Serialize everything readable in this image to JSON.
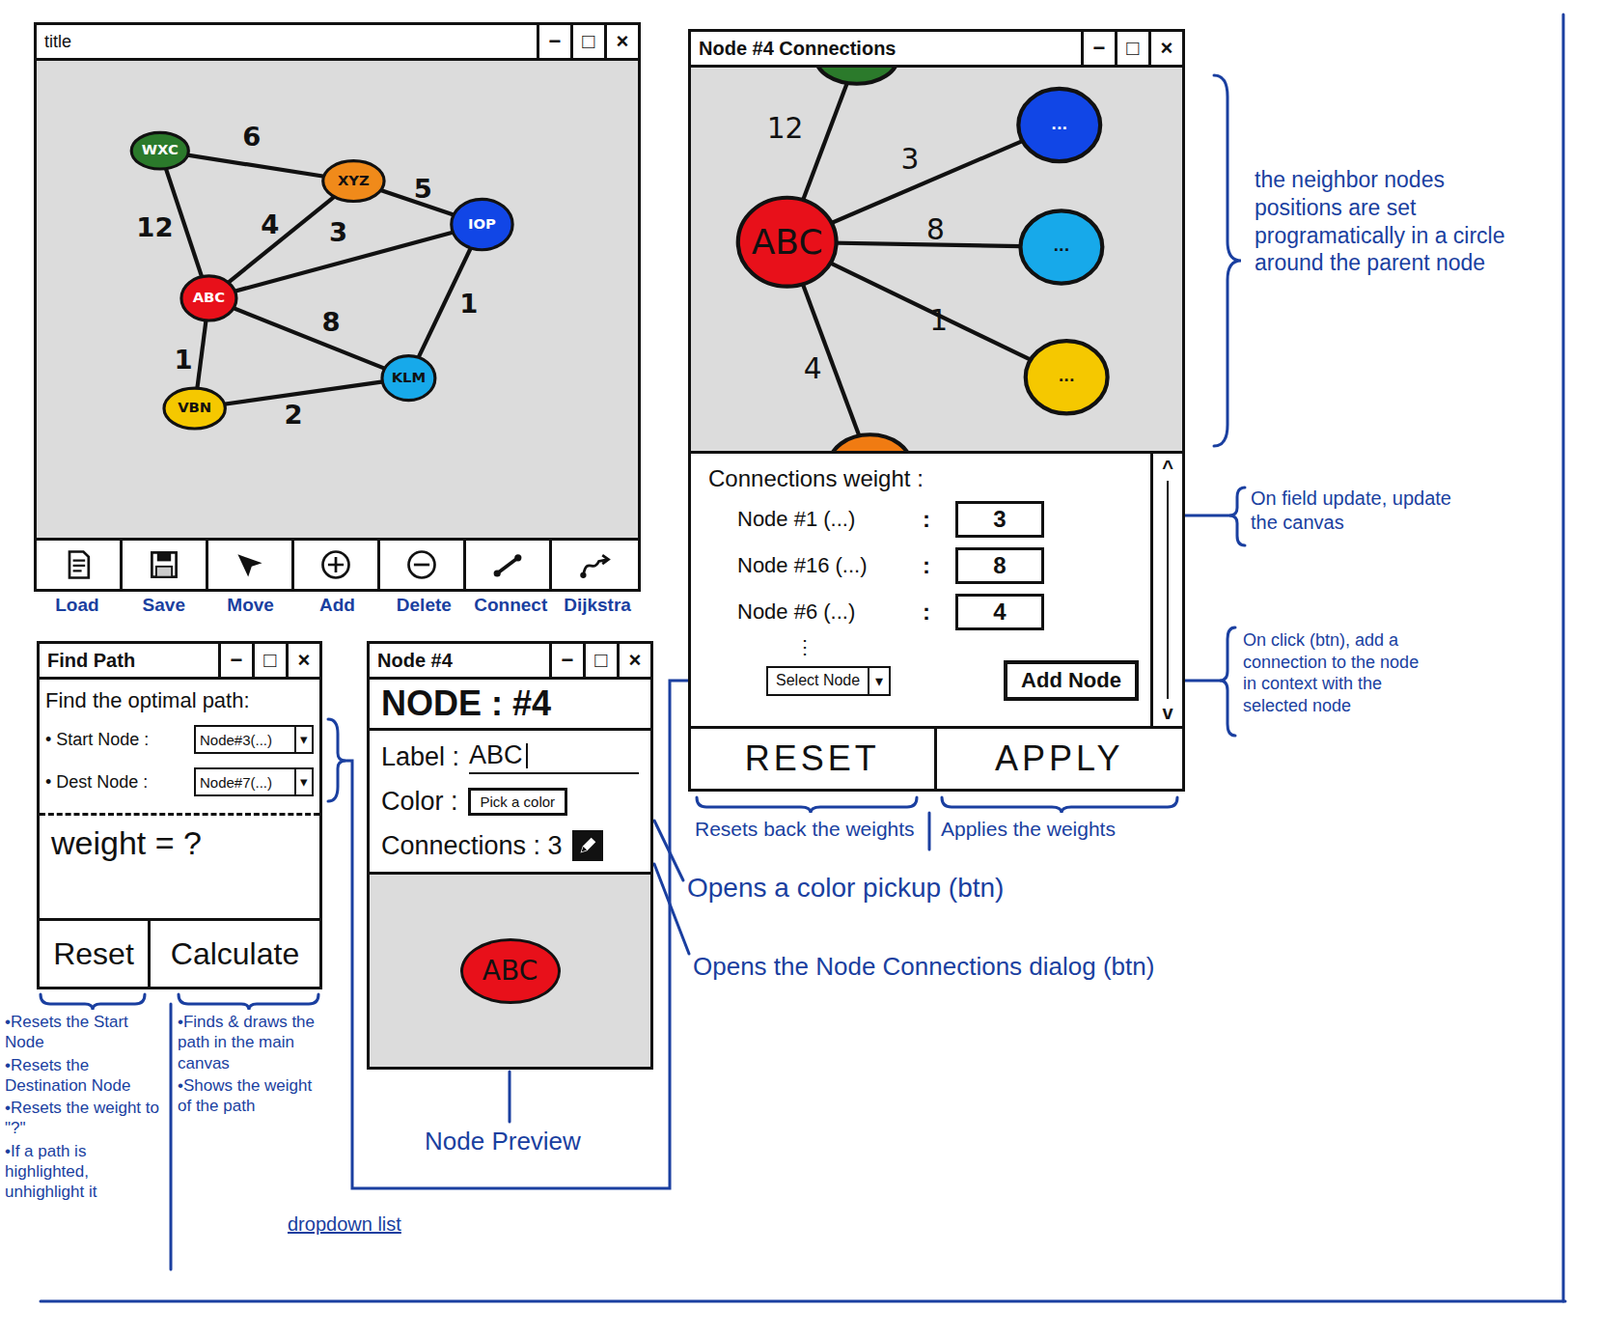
{
  "main_window": {
    "title": "title",
    "controls": [
      "−",
      "□",
      "×"
    ],
    "graph": {
      "nodes": [
        {
          "label": "WXC",
          "color": "#2b7a2b"
        },
        {
          "label": "XYZ",
          "color": "#f08a1a"
        },
        {
          "label": "IOP",
          "color": "#1146e6"
        },
        {
          "label": "ABC",
          "color": "#e8101a"
        },
        {
          "label": "VBN",
          "color": "#f5c800"
        },
        {
          "label": "KLM",
          "color": "#17a9ea"
        }
      ],
      "edges": [
        {
          "from": "WXC",
          "to": "XYZ",
          "weight": "6"
        },
        {
          "from": "WXC",
          "to": "ABC",
          "weight": "12"
        },
        {
          "from": "XYZ",
          "to": "ABC",
          "weight": "4"
        },
        {
          "from": "ABC",
          "to": "IOP",
          "weight": "3"
        },
        {
          "from": "XYZ",
          "to": "IOP",
          "weight": "5"
        },
        {
          "from": "ABC",
          "to": "KLM",
          "weight": "8"
        },
        {
          "from": "IOP",
          "to": "KLM",
          "weight": "1"
        },
        {
          "from": "ABC",
          "to": "VBN",
          "weight": "1"
        },
        {
          "from": "VBN",
          "to": "KLM",
          "weight": "2"
        }
      ]
    },
    "toolbar": [
      {
        "label": "Load"
      },
      {
        "label": "Save"
      },
      {
        "label": "Move"
      },
      {
        "label": "Add"
      },
      {
        "label": "Delete"
      },
      {
        "label": "Connect"
      },
      {
        "label": "Dijkstra"
      }
    ]
  },
  "connections_window": {
    "title": "Node #4 Connections",
    "controls": [
      "−",
      "□",
      "×"
    ],
    "parent": {
      "label": "ABC",
      "color": "#e8101a"
    },
    "neighbors": [
      {
        "label": "",
        "color": "#2b7a2b",
        "weight": "12"
      },
      {
        "label": "...",
        "color": "#1146e6",
        "weight": "3"
      },
      {
        "label": "...",
        "color": "#17a9ea",
        "weight": "8"
      },
      {
        "label": "...",
        "color": "#f5c800",
        "weight": "1"
      },
      {
        "label": "",
        "color": "#f07b12",
        "weight": "4"
      }
    ],
    "weights": {
      "heading": "Connections weight :",
      "rows": [
        {
          "label": "Node #1 (...)",
          "separator": ":",
          "value": "3"
        },
        {
          "label": "Node #16 (...)",
          "separator": ":",
          "value": "8"
        },
        {
          "label": "Node #6 (...)",
          "separator": ":",
          "value": "4"
        }
      ],
      "more": "⋮"
    },
    "select": {
      "placeholder": "Select Node",
      "arrow": "▾"
    },
    "add_button": "Add Node",
    "scroll_up": "^",
    "scroll_down": "v",
    "buttons": [
      "RESET",
      "APPLY"
    ]
  },
  "find_path_window": {
    "title": "Find Path",
    "controls": [
      "−",
      "□",
      "×"
    ],
    "heading": "Find the optimal path:",
    "rows": [
      {
        "bullet": "•",
        "label": "Start Node :",
        "value": "Node#3(...)",
        "arrow": "▾"
      },
      {
        "bullet": "•",
        "label": "Dest Node :",
        "value": "Node#7(...)",
        "arrow": "▾"
      }
    ],
    "weight": "weight = ?",
    "buttons": [
      "Reset",
      "Calculate"
    ]
  },
  "node_window": {
    "title": "Node #4",
    "controls": [
      "−",
      "□",
      "×"
    ],
    "heading": "NODE : #4",
    "label_field": {
      "label": "Label :",
      "value": "ABC",
      "focused": true
    },
    "color_field": {
      "label": "Color :",
      "button": "Pick a color"
    },
    "connections": {
      "label": "Connections :",
      "count": "3"
    },
    "preview": {
      "label": "ABC",
      "color": "#e8101a"
    }
  },
  "annotations": {
    "bullet": "•",
    "neighbors_note": "the neighbor nodes positions are set programatically in a circle around the parent node",
    "field_update_note": "On field update, update the canvas",
    "add_node_note": "On click (btn), add a connection to the node in context with the selected node",
    "reset_weights_note": "Resets back the weights",
    "apply_weights_note": "Applies the weights",
    "color_picker_note": "Opens a color pickup (btn)",
    "connections_dialog_note": "Opens the Node Connections dialog (btn)",
    "preview_note": "Node Preview",
    "dropdown_note": "dropdown list",
    "reset_notes": [
      "Resets the Start Node",
      "Resets the Destination Node",
      "Resets the weight to \"?\"",
      "If a path is highlighted, unhighlight it"
    ],
    "calculate_notes": [
      "Finds & draws the path in the main canvas",
      "Shows the weight of the path"
    ]
  }
}
